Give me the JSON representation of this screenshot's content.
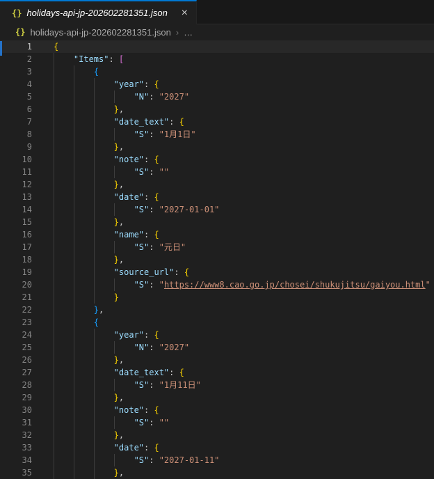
{
  "colors": {
    "accent_blue": "#0078d4",
    "editor_bg": "#1f1f1f",
    "tabbar_bg": "#181818",
    "key": "#9cdcfe",
    "string": "#ce9178",
    "bracket_gold": "#ffd700",
    "bracket_orchid": "#da70d6",
    "bracket_blue": "#179fff",
    "json_icon": "#cbcb41"
  },
  "icons": {
    "json_braces": "{}"
  },
  "tab": {
    "title": "holidays-api-jp-202602281351.json",
    "close_icon": "×"
  },
  "breadcrumb": {
    "file": "holidays-api-jp-202602281351.json",
    "separator": "›",
    "more": "…"
  },
  "editor": {
    "active_line": 1,
    "lines": [
      {
        "n": 1,
        "indent": 0,
        "tokens": [
          [
            "{",
            "b1"
          ]
        ]
      },
      {
        "n": 2,
        "indent": 1,
        "tokens": [
          [
            "\"Items\"",
            "k"
          ],
          [
            ": ",
            "p"
          ],
          [
            "[",
            "b2"
          ]
        ]
      },
      {
        "n": 3,
        "indent": 2,
        "tokens": [
          [
            "{",
            "b3"
          ]
        ]
      },
      {
        "n": 4,
        "indent": 3,
        "tokens": [
          [
            "\"year\"",
            "k"
          ],
          [
            ": ",
            "p"
          ],
          [
            "{",
            "b1"
          ]
        ]
      },
      {
        "n": 5,
        "indent": 4,
        "tokens": [
          [
            "\"N\"",
            "k"
          ],
          [
            ": ",
            "p"
          ],
          [
            "\"2027\"",
            "s"
          ]
        ]
      },
      {
        "n": 6,
        "indent": 3,
        "tokens": [
          [
            "}",
            "b1"
          ],
          [
            ",",
            "p"
          ]
        ]
      },
      {
        "n": 7,
        "indent": 3,
        "tokens": [
          [
            "\"date_text\"",
            "k"
          ],
          [
            ": ",
            "p"
          ],
          [
            "{",
            "b1"
          ]
        ]
      },
      {
        "n": 8,
        "indent": 4,
        "tokens": [
          [
            "\"S\"",
            "k"
          ],
          [
            ": ",
            "p"
          ],
          [
            "\"1月1日\"",
            "s"
          ]
        ]
      },
      {
        "n": 9,
        "indent": 3,
        "tokens": [
          [
            "}",
            "b1"
          ],
          [
            ",",
            "p"
          ]
        ]
      },
      {
        "n": 10,
        "indent": 3,
        "tokens": [
          [
            "\"note\"",
            "k"
          ],
          [
            ": ",
            "p"
          ],
          [
            "{",
            "b1"
          ]
        ]
      },
      {
        "n": 11,
        "indent": 4,
        "tokens": [
          [
            "\"S\"",
            "k"
          ],
          [
            ": ",
            "p"
          ],
          [
            "\"\"",
            "s"
          ]
        ]
      },
      {
        "n": 12,
        "indent": 3,
        "tokens": [
          [
            "}",
            "b1"
          ],
          [
            ",",
            "p"
          ]
        ]
      },
      {
        "n": 13,
        "indent": 3,
        "tokens": [
          [
            "\"date\"",
            "k"
          ],
          [
            ": ",
            "p"
          ],
          [
            "{",
            "b1"
          ]
        ]
      },
      {
        "n": 14,
        "indent": 4,
        "tokens": [
          [
            "\"S\"",
            "k"
          ],
          [
            ": ",
            "p"
          ],
          [
            "\"2027-01-01\"",
            "s"
          ]
        ]
      },
      {
        "n": 15,
        "indent": 3,
        "tokens": [
          [
            "}",
            "b1"
          ],
          [
            ",",
            "p"
          ]
        ]
      },
      {
        "n": 16,
        "indent": 3,
        "tokens": [
          [
            "\"name\"",
            "k"
          ],
          [
            ": ",
            "p"
          ],
          [
            "{",
            "b1"
          ]
        ]
      },
      {
        "n": 17,
        "indent": 4,
        "tokens": [
          [
            "\"S\"",
            "k"
          ],
          [
            ": ",
            "p"
          ],
          [
            "\"元日\"",
            "s"
          ]
        ]
      },
      {
        "n": 18,
        "indent": 3,
        "tokens": [
          [
            "}",
            "b1"
          ],
          [
            ",",
            "p"
          ]
        ]
      },
      {
        "n": 19,
        "indent": 3,
        "tokens": [
          [
            "\"source_url\"",
            "k"
          ],
          [
            ": ",
            "p"
          ],
          [
            "{",
            "b1"
          ]
        ]
      },
      {
        "n": 20,
        "indent": 4,
        "tokens": [
          [
            "\"S\"",
            "k"
          ],
          [
            ": ",
            "p"
          ],
          [
            "\"",
            "s"
          ],
          [
            "https://www8.cao.go.jp/chosei/shukujitsu/gaiyou.html",
            "u"
          ],
          [
            "\"",
            "s"
          ]
        ]
      },
      {
        "n": 21,
        "indent": 3,
        "tokens": [
          [
            "}",
            "b1"
          ]
        ]
      },
      {
        "n": 22,
        "indent": 2,
        "tokens": [
          [
            "}",
            "b3"
          ],
          [
            ",",
            "p"
          ]
        ]
      },
      {
        "n": 23,
        "indent": 2,
        "tokens": [
          [
            "{",
            "b3"
          ]
        ]
      },
      {
        "n": 24,
        "indent": 3,
        "tokens": [
          [
            "\"year\"",
            "k"
          ],
          [
            ": ",
            "p"
          ],
          [
            "{",
            "b1"
          ]
        ]
      },
      {
        "n": 25,
        "indent": 4,
        "tokens": [
          [
            "\"N\"",
            "k"
          ],
          [
            ": ",
            "p"
          ],
          [
            "\"2027\"",
            "s"
          ]
        ]
      },
      {
        "n": 26,
        "indent": 3,
        "tokens": [
          [
            "}",
            "b1"
          ],
          [
            ",",
            "p"
          ]
        ]
      },
      {
        "n": 27,
        "indent": 3,
        "tokens": [
          [
            "\"date_text\"",
            "k"
          ],
          [
            ": ",
            "p"
          ],
          [
            "{",
            "b1"
          ]
        ]
      },
      {
        "n": 28,
        "indent": 4,
        "tokens": [
          [
            "\"S\"",
            "k"
          ],
          [
            ": ",
            "p"
          ],
          [
            "\"1月11日\"",
            "s"
          ]
        ]
      },
      {
        "n": 29,
        "indent": 3,
        "tokens": [
          [
            "}",
            "b1"
          ],
          [
            ",",
            "p"
          ]
        ]
      },
      {
        "n": 30,
        "indent": 3,
        "tokens": [
          [
            "\"note\"",
            "k"
          ],
          [
            ": ",
            "p"
          ],
          [
            "{",
            "b1"
          ]
        ]
      },
      {
        "n": 31,
        "indent": 4,
        "tokens": [
          [
            "\"S\"",
            "k"
          ],
          [
            ": ",
            "p"
          ],
          [
            "\"\"",
            "s"
          ]
        ]
      },
      {
        "n": 32,
        "indent": 3,
        "tokens": [
          [
            "}",
            "b1"
          ],
          [
            ",",
            "p"
          ]
        ]
      },
      {
        "n": 33,
        "indent": 3,
        "tokens": [
          [
            "\"date\"",
            "k"
          ],
          [
            ": ",
            "p"
          ],
          [
            "{",
            "b1"
          ]
        ]
      },
      {
        "n": 34,
        "indent": 4,
        "tokens": [
          [
            "\"S\"",
            "k"
          ],
          [
            ": ",
            "p"
          ],
          [
            "\"2027-01-11\"",
            "s"
          ]
        ]
      },
      {
        "n": 35,
        "indent": 3,
        "tokens": [
          [
            "}",
            "b1"
          ],
          [
            ",",
            "p"
          ]
        ]
      }
    ]
  }
}
